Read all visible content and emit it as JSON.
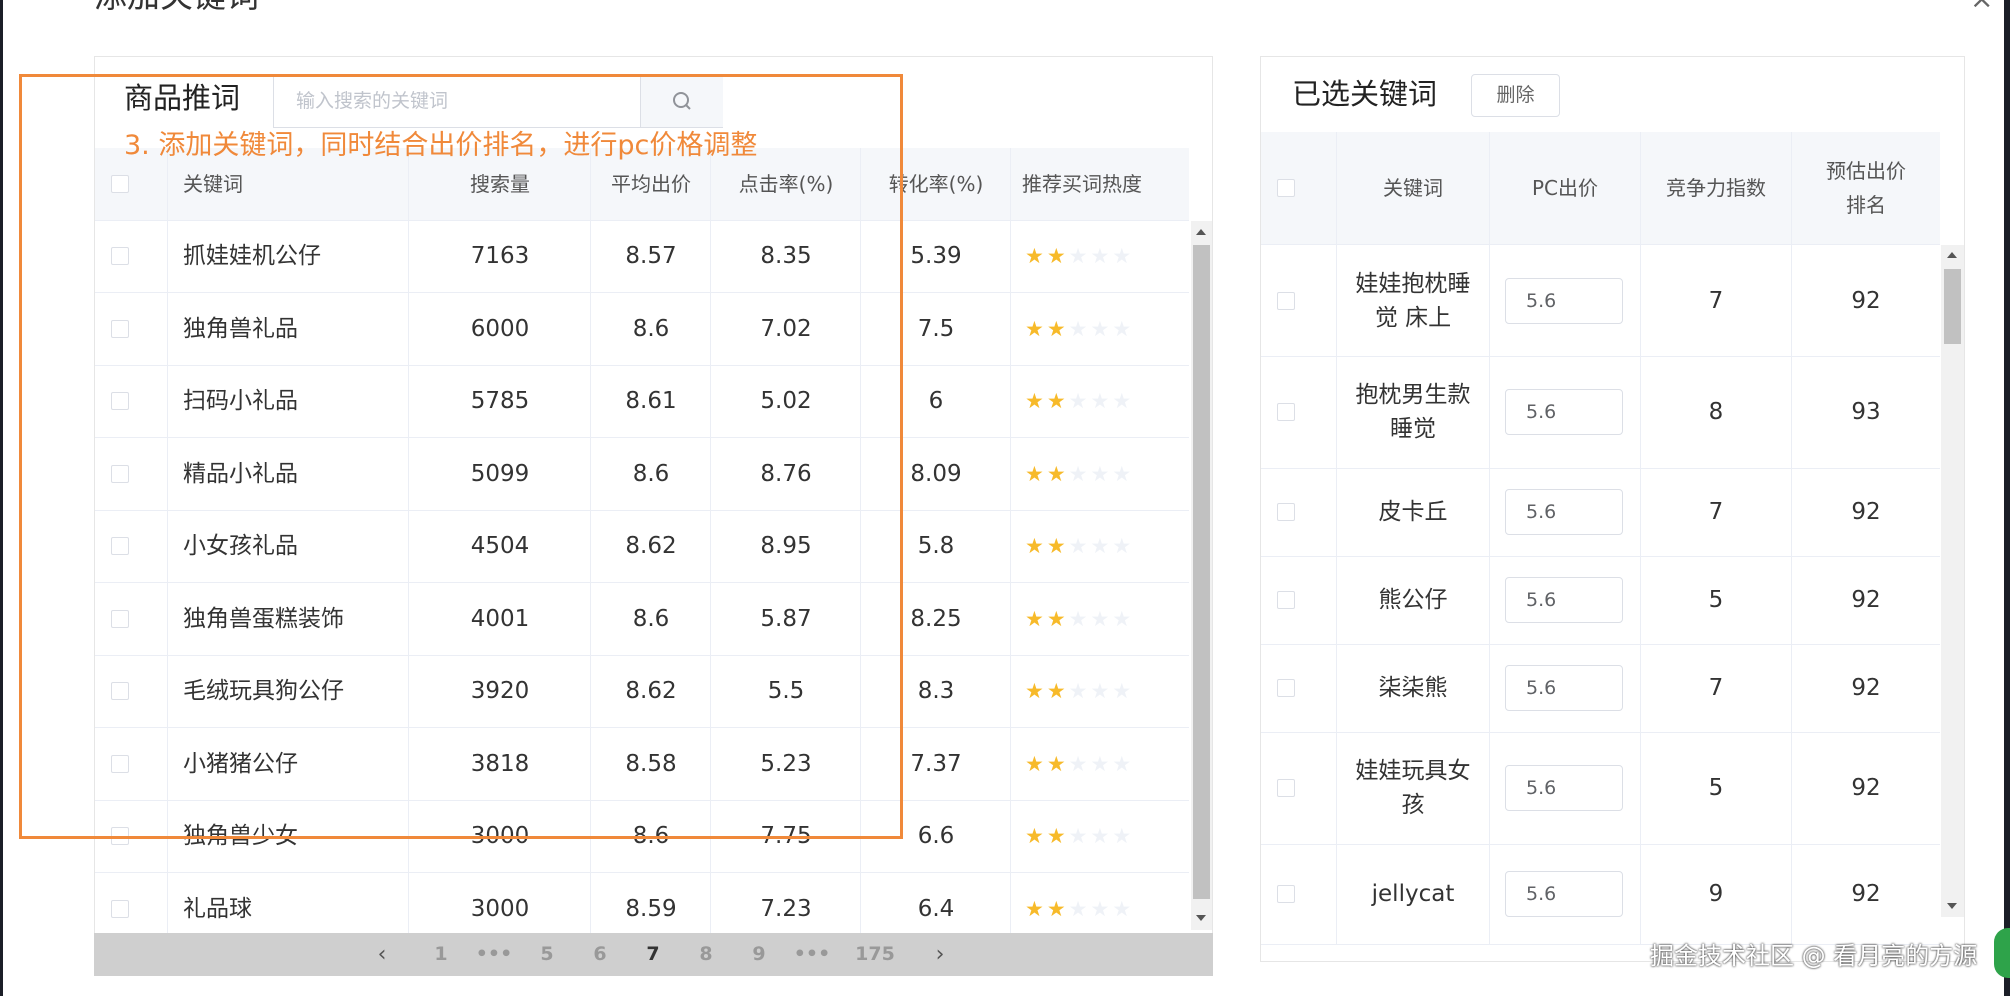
{
  "dialog": {
    "title": "添加关键词",
    "close_glyph": "×"
  },
  "left_panel": {
    "title": "商品推词",
    "search": {
      "placeholder": "输入搜索的关键词",
      "value": ""
    },
    "columns": [
      "关键词",
      "搜索量",
      "平均出价",
      "点击率(%)",
      "转化率(%)",
      "推荐买词热度"
    ],
    "rows": [
      {
        "keyword": "抓娃娃机公仔",
        "volume": "7163",
        "avg_bid": "8.57",
        "ctr": "8.35",
        "cvr": "5.39",
        "stars": 2
      },
      {
        "keyword": "独角兽礼品",
        "volume": "6000",
        "avg_bid": "8.6",
        "ctr": "7.02",
        "cvr": "7.5",
        "stars": 2
      },
      {
        "keyword": "扫码小礼品",
        "volume": "5785",
        "avg_bid": "8.61",
        "ctr": "5.02",
        "cvr": "6",
        "stars": 2
      },
      {
        "keyword": "精品小礼品",
        "volume": "5099",
        "avg_bid": "8.6",
        "ctr": "8.76",
        "cvr": "8.09",
        "stars": 2
      },
      {
        "keyword": "小女孩礼品",
        "volume": "4504",
        "avg_bid": "8.62",
        "ctr": "8.95",
        "cvr": "5.8",
        "stars": 2
      },
      {
        "keyword": "独角兽蛋糕装饰",
        "volume": "4001",
        "avg_bid": "8.6",
        "ctr": "5.87",
        "cvr": "8.25",
        "stars": 2
      },
      {
        "keyword": "毛绒玩具狗公仔",
        "volume": "3920",
        "avg_bid": "8.62",
        "ctr": "5.5",
        "cvr": "8.3",
        "stars": 2
      },
      {
        "keyword": "小猪猪公仔",
        "volume": "3818",
        "avg_bid": "8.58",
        "ctr": "5.23",
        "cvr": "7.37",
        "stars": 2
      },
      {
        "keyword": "独角兽少女",
        "volume": "3000",
        "avg_bid": "8.6",
        "ctr": "7.75",
        "cvr": "6.6",
        "stars": 2
      },
      {
        "keyword": "礼品球",
        "volume": "3000",
        "avg_bid": "8.59",
        "ctr": "7.23",
        "cvr": "6.4",
        "stars": 2
      }
    ],
    "pagination": {
      "prev": "‹",
      "next": "›",
      "pages": [
        "1",
        "•••",
        "5",
        "6",
        "7",
        "8",
        "9",
        "•••",
        "175"
      ],
      "current": "7"
    }
  },
  "annotation": {
    "text": "3. 添加关键词，同时结合出价排名，进行pc价格调整",
    "color": "#f0893a"
  },
  "right_panel": {
    "title": "已选关键词",
    "delete_label": "删除",
    "columns": [
      "关键词",
      "PC出价",
      "竞争力指数",
      "预估出价排名"
    ],
    "rows": [
      {
        "keyword": "娃娃抱枕睡觉 床上",
        "pc_bid": "5.6",
        "competition": "7",
        "rank": "92"
      },
      {
        "keyword": "抱枕男生款睡觉",
        "pc_bid": "5.6",
        "competition": "8",
        "rank": "93"
      },
      {
        "keyword": "皮卡丘",
        "pc_bid": "5.6",
        "competition": "7",
        "rank": "92"
      },
      {
        "keyword": "熊公仔",
        "pc_bid": "5.6",
        "competition": "5",
        "rank": "92"
      },
      {
        "keyword": "柒柒熊",
        "pc_bid": "5.6",
        "competition": "7",
        "rank": "92"
      },
      {
        "keyword": "娃娃玩具女孩",
        "pc_bid": "5.6",
        "competition": "5",
        "rank": "92"
      },
      {
        "keyword": "jellycat",
        "pc_bid": "5.6",
        "competition": "9",
        "rank": "92"
      }
    ]
  },
  "watermark": "掘金技术社区 @ 看月亮的方源",
  "colors": {
    "star_on": "#f7ba2a",
    "star_off": "#eff2f7",
    "annotation": "#f0893a",
    "header_bg": "#f5f7fa"
  }
}
